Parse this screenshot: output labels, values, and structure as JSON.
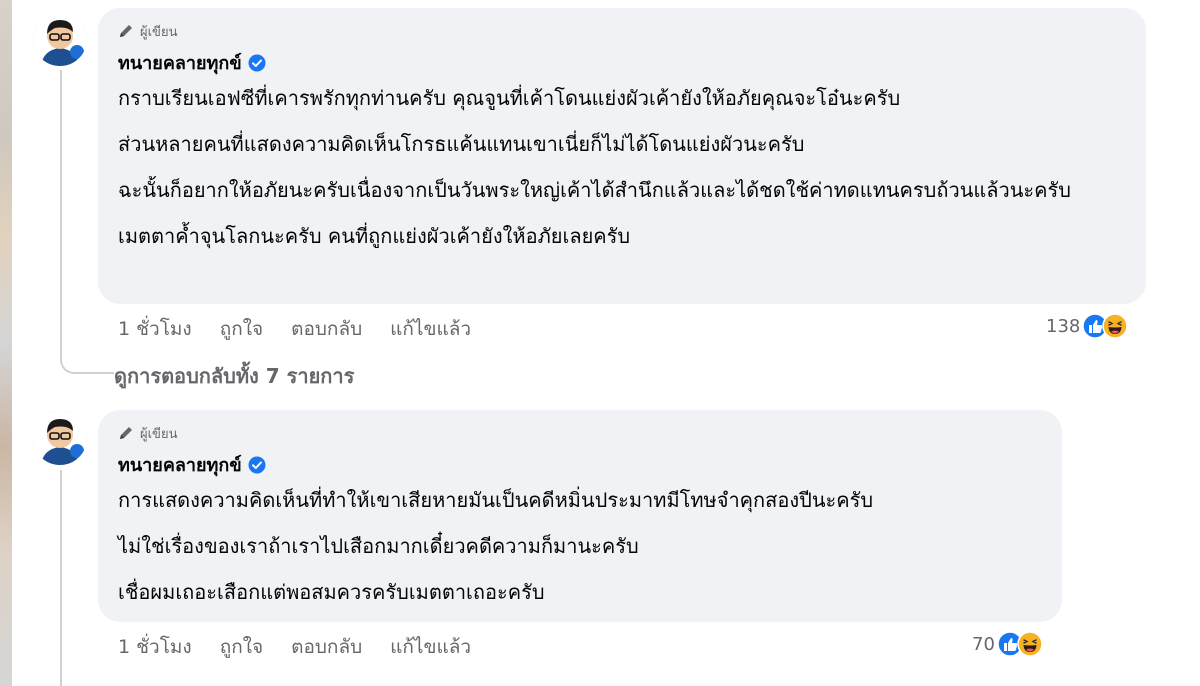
{
  "comments": [
    {
      "badge": "ผู้เขียน",
      "author": "ทนายคลายทุกข์",
      "paragraphs": [
        "กราบเรียนเอฟซีที่เคารพรักทุกท่านครับ คุณจูนที่เค้าโดนแย่งผัวเค้ายังให้อภัยคุณจะโอ๋นะครับ",
        "ส่วนหลายคนที่แสดงความคิดเห็นโกรธแค้นแทนเขาเนี่ยก็ไม่ได้โดนแย่งผัวนะครับ",
        "ฉะนั้นก็อยากให้อภัยนะครับเนื่องจากเป็นวันพระใหญ่เค้าได้สำนึกแล้วและได้ชดใช้ค่าทดแทนครบถ้วนแล้วนะครับ",
        "เมตตาค้ำจุนโลกนะครับ คนที่ถูกแย่งผัวเค้ายังให้อภัยเลยครับ"
      ],
      "time": "1 ชั่วโมง",
      "like_label": "ถูกใจ",
      "reply_label": "ตอบกลับ",
      "edited_label": "แก้ไขแล้ว",
      "reaction_count": "138"
    },
    {
      "badge": "ผู้เขียน",
      "author": "ทนายคลายทุกข์",
      "paragraphs": [
        "การแสดงความคิดเห็นที่ทำให้เขาเสียหายมันเป็นคดีหมิ่นประมาทมีโทษจำคุกสองปีนะครับ",
        "ไม่ใช่เรื่องของเราถ้าเราไปเสือกมากเดี๋ยวคดีความก็มานะครับ",
        "เชื่อผมเถอะเสือกแต่พอสมควรครับเมตตาเถอะครับ"
      ],
      "time": "1 ชั่วโมง",
      "like_label": "ถูกใจ",
      "reply_label": "ตอบกลับ",
      "edited_label": "แก้ไขแล้ว",
      "reaction_count": "70"
    }
  ],
  "view_replies": "ดูการตอบกลับทั้ง 7 รายการ",
  "colors": {
    "bubble": "#f0f2f5",
    "secondary_text": "#65676b",
    "verified": "#1877f2",
    "like": "#1877f2",
    "haha": "#f7b125"
  },
  "icons": [
    "pen-icon",
    "verified-icon",
    "like-reaction-icon",
    "haha-reaction-icon"
  ]
}
